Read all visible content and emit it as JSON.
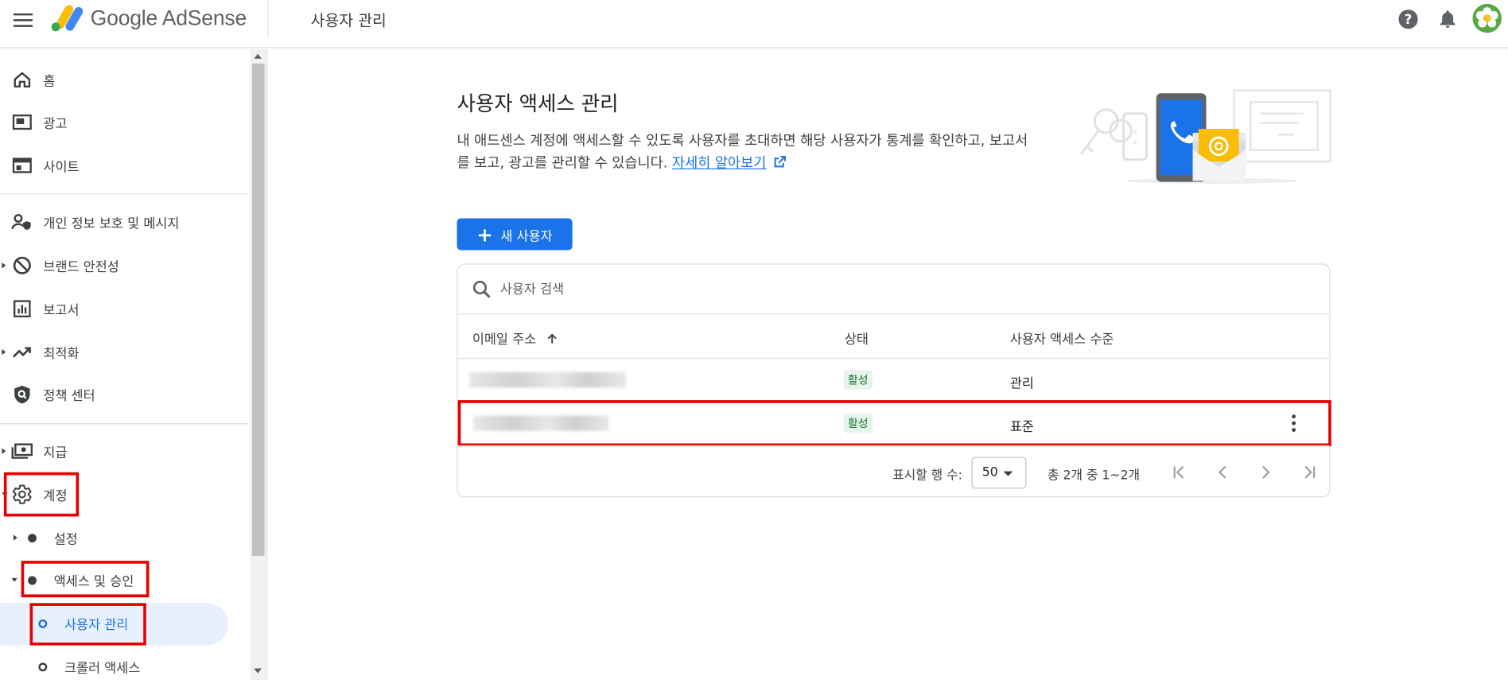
{
  "app": {
    "logo_text": "Google AdSense",
    "page_title": "사용자 관리"
  },
  "sidebar": {
    "items": [
      {
        "label": "홈",
        "icon": "home-icon"
      },
      {
        "label": "광고",
        "icon": "ads-icon"
      },
      {
        "label": "사이트",
        "icon": "sites-icon"
      },
      {
        "label": "개인 정보 보호 및 메시지",
        "icon": "privacy-icon"
      },
      {
        "label": "브랜드 안전성",
        "icon": "block-icon"
      },
      {
        "label": "보고서",
        "icon": "report-icon"
      },
      {
        "label": "최적화",
        "icon": "trending-icon"
      },
      {
        "label": "정책 센터",
        "icon": "policy-icon"
      },
      {
        "label": "지급",
        "icon": "payments-icon"
      },
      {
        "label": "계정",
        "icon": "gear-icon"
      }
    ],
    "sub_items": [
      {
        "label": "설정"
      },
      {
        "label": "액세스 및 승인"
      }
    ],
    "sub_sub_items": [
      {
        "label": "사용자 관리",
        "active": true
      },
      {
        "label": "크롤러 액세스"
      }
    ]
  },
  "main": {
    "heading": "사용자 액세스 관리",
    "description": "내 애드센스 계정에 액세스할 수 있도록 사용자를 초대하면 해당 사용자가 통계를 확인하고, 보고서를 보고, 광고를 관리할 수 있습니다. ",
    "learn_more": "자세히 알아보기",
    "new_user_button": "새 사용자",
    "search_placeholder": "사용자 검색",
    "table": {
      "columns": [
        "이메일 주소",
        "상태",
        "사용자 액세스 수준"
      ],
      "rows": [
        {
          "status": "활성",
          "access": "관리"
        },
        {
          "status": "활성",
          "access": "표준"
        }
      ]
    },
    "pagination": {
      "rows_label": "표시할 행 수:",
      "rows_value": "50",
      "range": "총 2개 중 1~2개"
    }
  },
  "colors": {
    "accent": "#1a73e8",
    "highlight": "#e60000",
    "active_status_bg": "#e6f4ea",
    "active_status_text": "#137333"
  }
}
